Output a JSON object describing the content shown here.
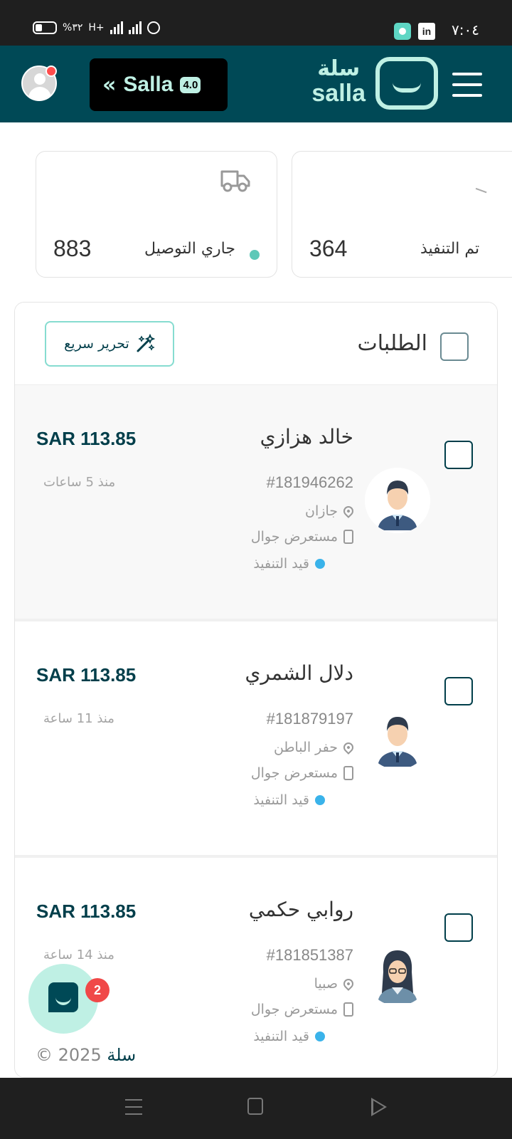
{
  "status_bar": {
    "time": "٧:٠٤",
    "battery": "%٣٢",
    "network": "H+",
    "app_badge": "in"
  },
  "header": {
    "logo_ar": "سلة",
    "logo_en": "salla",
    "promo_word": "Salla",
    "promo_version": "4.0",
    "promo_chevron": "«"
  },
  "stats": [
    {
      "label": "جاري التوصيل",
      "value": "883",
      "dot_color": "#5ec8b8",
      "icon": "truck-icon"
    },
    {
      "label": "تم التنفيذ",
      "value": "364"
    }
  ],
  "orders_panel": {
    "title": "الطلبات",
    "quick_edit_label": "تحرير سريع"
  },
  "orders": [
    {
      "name": "خالد هزازي",
      "price": "SAR 113.85",
      "time": "منذ 5 ساعات",
      "number": "#181946262",
      "city": "جازان",
      "source": "مستعرض جوال",
      "status": "قيد التنفيذ",
      "avatar": "male"
    },
    {
      "name": "دلال الشمري",
      "price": "SAR 113.85",
      "time": "منذ 11 ساعة",
      "number": "#181879197",
      "city": "حفر الباطن",
      "source": "مستعرض جوال",
      "status": "قيد التنفيذ",
      "avatar": "male"
    },
    {
      "name": "روابي حكمي",
      "price": "SAR 113.85",
      "time": "منذ 14 ساعة",
      "number": "#181851387",
      "city": "صبيا",
      "source": "مستعرض جوال",
      "status": "قيد التنفيذ",
      "avatar": "female"
    }
  ],
  "chat": {
    "count": "2"
  },
  "footer": {
    "brand": "سلة",
    "copy": "© 2025"
  },
  "colors": {
    "primary": "#004956",
    "accent": "#bff0e4",
    "status_blue": "#3ab3ea",
    "notification": "#f04848"
  }
}
